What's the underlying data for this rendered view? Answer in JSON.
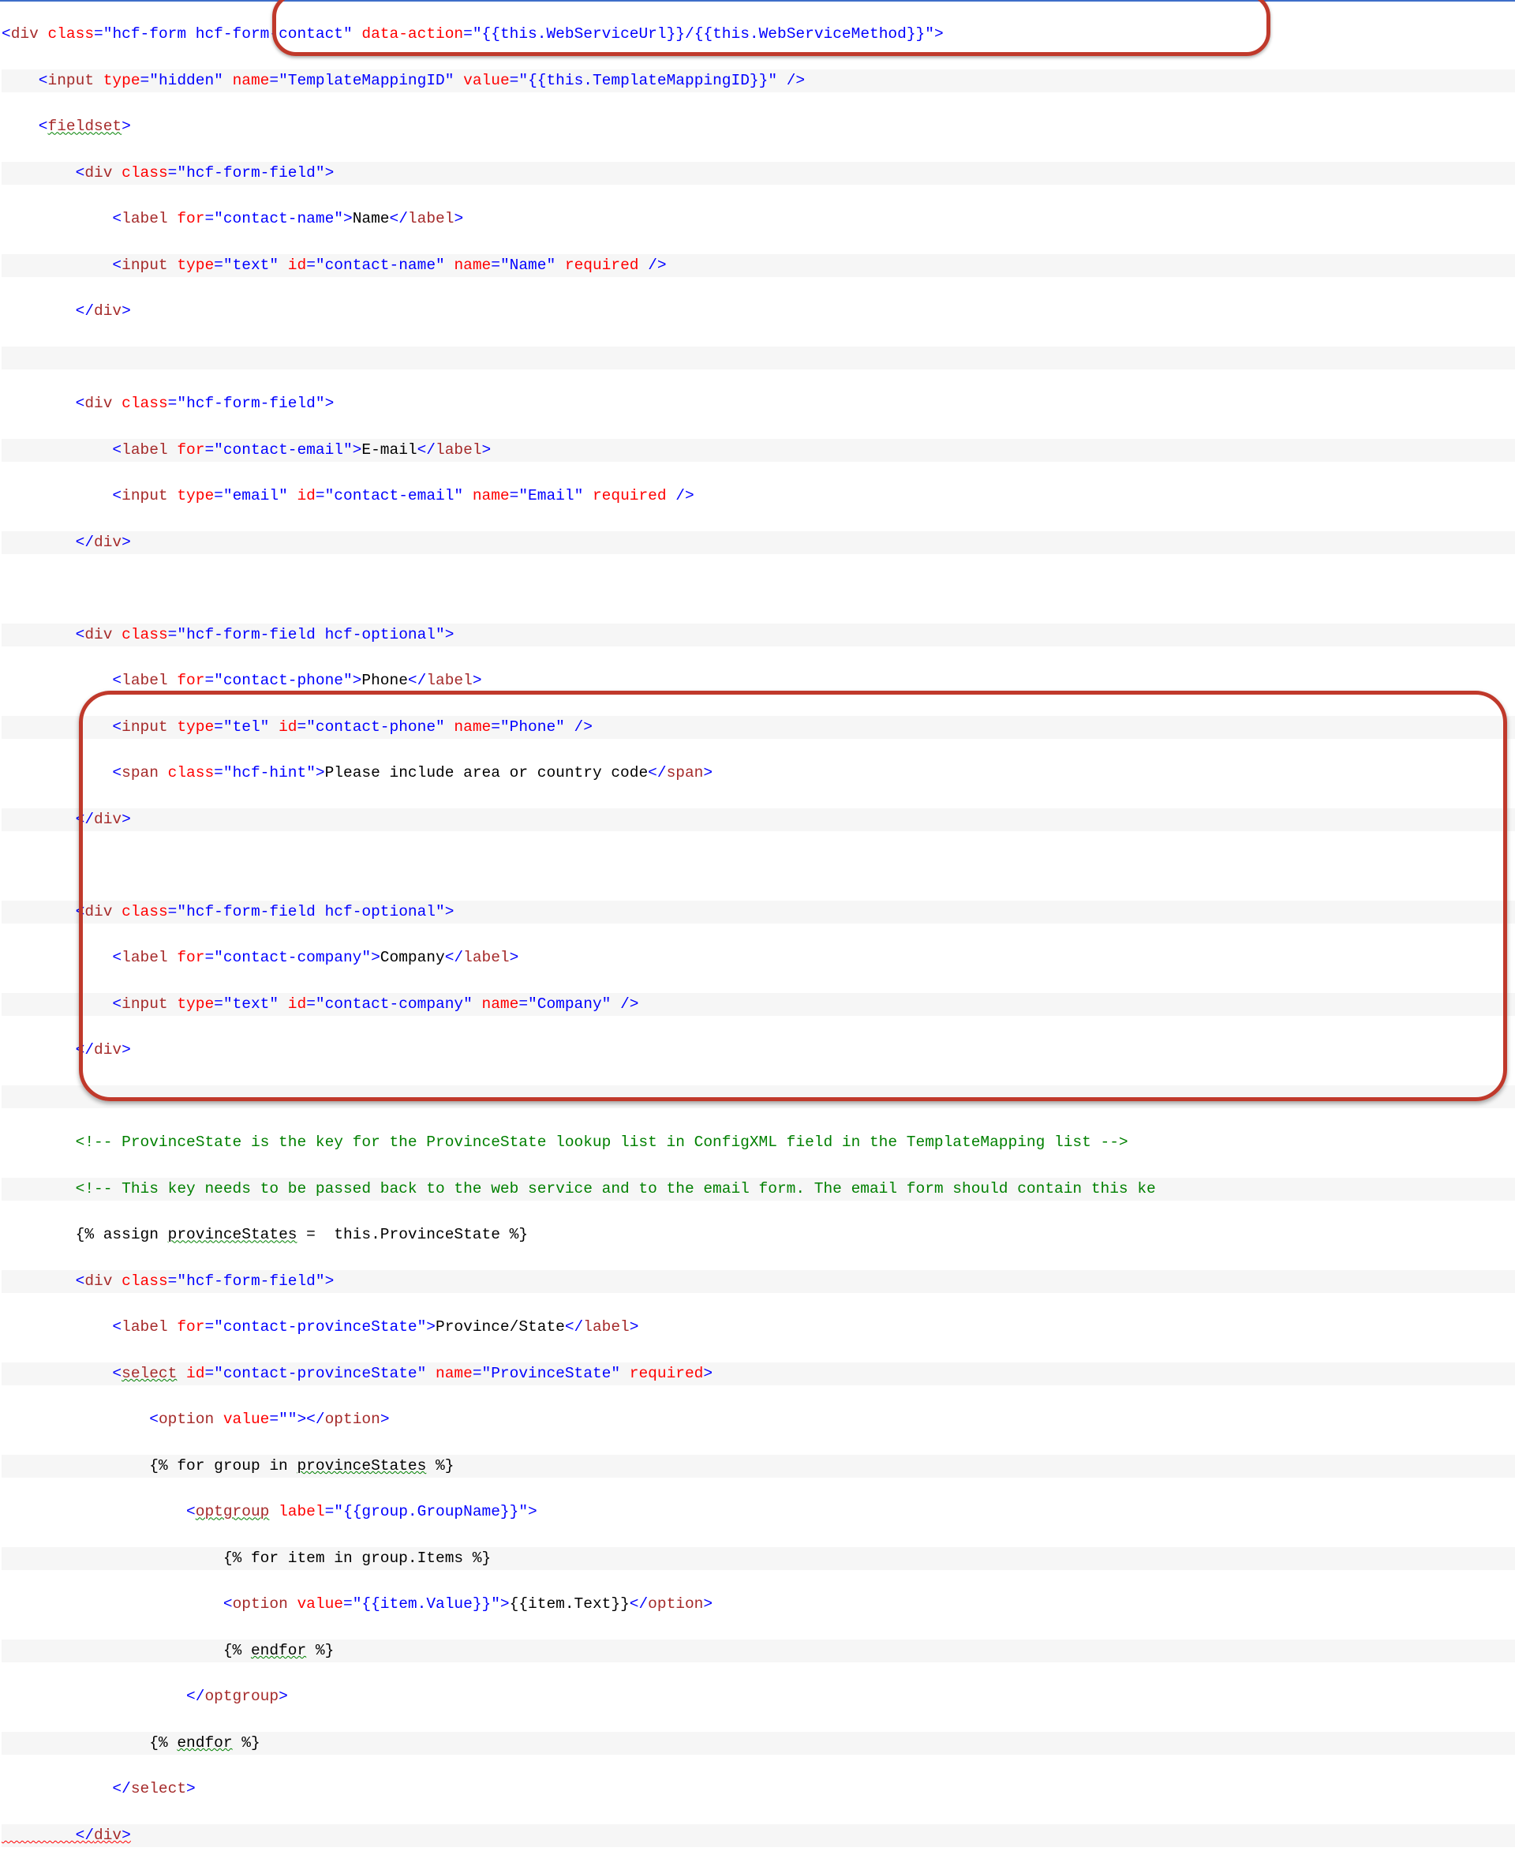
{
  "lines": {
    "l1a": "<",
    "l1_div": "div",
    "l1b": " ",
    "l1_class": "class",
    "l1c": "=\"",
    "l1_classv": "hcf-form hcf-form-contact",
    "l1d": "\" ",
    "l1_action": "data-action",
    "l1e": "=\"",
    "l1_actionv": "{{this.WebServiceUrl}}/{{this.WebServiceMethod}}",
    "l1f": "\">",
    "l2a": "    <",
    "l2_input": "input",
    "l2b": " ",
    "l2_type": "type",
    "l2c": "=\"",
    "l2_typev": "hidden",
    "l2d": "\" ",
    "l2_name": "name",
    "l2e": "=\"",
    "l2_namev": "TemplateMappingID",
    "l2f": "\" ",
    "l2_value": "value",
    "l2g": "=\"",
    "l2_valuev": "{{this.TemplateMappingID}}",
    "l2h": "\" />",
    "l3": "    <",
    "l3_fs": "fieldset",
    "l3b": ">",
    "l4": "        <",
    "l4_div": "div",
    "l4b": " ",
    "l4_class": "class",
    "l4c": "=\"",
    "l4_classv": "hcf-form-field",
    "l4d": "\">",
    "l5": "            <",
    "l5_label": "label",
    "l5b": " ",
    "l5_for": "for",
    "l5c": "=\"",
    "l5_forv": "contact-name",
    "l5d": "\">",
    "l5_txt": "Name",
    "l5e": "</",
    "l5_label2": "label",
    "l5f": ">",
    "l6": "            <",
    "l6_input": "input",
    "l6b": " ",
    "l6_type": "type",
    "l6c": "=\"",
    "l6_typev": "text",
    "l6d": "\" ",
    "l6_id": "id",
    "l6e": "=\"",
    "l6_idv": "contact-name",
    "l6f": "\" ",
    "l6_name": "name",
    "l6g": "=\"",
    "l6_namev": "Name",
    "l6h": "\" ",
    "l6_req": "required",
    "l6i": " />",
    "l7": "        </",
    "l7_div": "div",
    "l7b": ">",
    "l8": " ",
    "l9": "        <",
    "l9_div": "div",
    "l9b": " ",
    "l9_class": "class",
    "l9c": "=\"",
    "l9_classv": "hcf-form-field",
    "l9d": "\">",
    "l10": "            <",
    "l10_label": "label",
    "l10b": " ",
    "l10_for": "for",
    "l10c": "=\"",
    "l10_forv": "contact-email",
    "l10d": "\">",
    "l10_txt": "E-mail",
    "l10e": "</",
    "l10_label2": "label",
    "l10f": ">",
    "l11": "            <",
    "l11_input": "input",
    "l11b": " ",
    "l11_type": "type",
    "l11c": "=\"",
    "l11_typev": "email",
    "l11d": "\" ",
    "l11_id": "id",
    "l11e": "=\"",
    "l11_idv": "contact-email",
    "l11f": "\" ",
    "l11_name": "name",
    "l11g": "=\"",
    "l11_namev": "Email",
    "l11h": "\" ",
    "l11_req": "required",
    "l11i": " />",
    "l12": "        </",
    "l12_div": "div",
    "l12b": ">",
    "l13": " ",
    "l14": "        <",
    "l14_div": "div",
    "l14b": " ",
    "l14_class": "class",
    "l14c": "=\"",
    "l14_classv": "hcf-form-field hcf-optional",
    "l14d": "\">",
    "l15": "            <",
    "l15_label": "label",
    "l15b": " ",
    "l15_for": "for",
    "l15c": "=\"",
    "l15_forv": "contact-phone",
    "l15d": "\">",
    "l15_txt": "Phone",
    "l15e": "</",
    "l15_label2": "label",
    "l15f": ">",
    "l16": "            <",
    "l16_input": "input",
    "l16b": " ",
    "l16_type": "type",
    "l16c": "=\"",
    "l16_typev": "tel",
    "l16d": "\" ",
    "l16_id": "id",
    "l16e": "=\"",
    "l16_idv": "contact-phone",
    "l16f": "\" ",
    "l16_name": "name",
    "l16g": "=\"",
    "l16_namev": "Phone",
    "l16h": "\" />",
    "l17": "            <",
    "l17_span": "span",
    "l17b": " ",
    "l17_class": "class",
    "l17c": "=\"",
    "l17_classv": "hcf-hint",
    "l17d": "\">",
    "l17_txt": "Please include area or country code",
    "l17e": "</",
    "l17_span2": "span",
    "l17f": ">",
    "l18": "        </",
    "l18_div": "div",
    "l18b": ">",
    "l19": " ",
    "l20": "        <",
    "l20_div": "div",
    "l20b": " ",
    "l20_class": "class",
    "l20c": "=\"",
    "l20_classv": "hcf-form-field hcf-optional",
    "l20d": "\">",
    "l21": "            <",
    "l21_label": "label",
    "l21b": " ",
    "l21_for": "for",
    "l21c": "=\"",
    "l21_forv": "contact-company",
    "l21d": "\">",
    "l21_txt": "Company",
    "l21e": "</",
    "l21_label2": "label",
    "l21f": ">",
    "l22": "            <",
    "l22_input": "input",
    "l22b": " ",
    "l22_type": "type",
    "l22c": "=\"",
    "l22_typev": "text",
    "l22d": "\" ",
    "l22_id": "id",
    "l22e": "=\"",
    "l22_idv": "contact-company",
    "l22f": "\" ",
    "l22_name": "name",
    "l22g": "=\"",
    "l22_namev": "Company",
    "l22h": "\" />",
    "l23": "        </",
    "l23_div": "div",
    "l23b": ">",
    "l24": " ",
    "l25": "        <!-- ProvinceState is the key for the ProvinceState lookup list in ConfigXML field in the TemplateMapping list -->",
    "l26": "        <!-- This key needs to be passed back to the web service and to the email form. The email form should contain this ke",
    "l27": "        {% assign ",
    "l27_ps": "provinceStates",
    "l27b": " =  this.ProvinceState %}",
    "l28": "        <",
    "l28_div": "div",
    "l28b": " ",
    "l28_class": "class",
    "l28c": "=\"",
    "l28_classv": "hcf-form-field",
    "l28d": "\">",
    "l29": "            <",
    "l29_label": "label",
    "l29b": " ",
    "l29_for": "for",
    "l29c": "=\"",
    "l29_forv": "contact-provinceState",
    "l29d": "\">",
    "l29_txt": "Province/State",
    "l29e": "</",
    "l29_label2": "label",
    "l29f": ">",
    "l30": "            <",
    "l30_select": "select",
    "l30b": " ",
    "l30_id": "id",
    "l30c": "=\"",
    "l30_idv": "contact-provinceState",
    "l30d": "\" ",
    "l30_name": "name",
    "l30e": "=\"",
    "l30_namev": "ProvinceState",
    "l30f": "\" ",
    "l30_req": "required",
    "l30g": ">",
    "l31": "                <",
    "l31_option": "option",
    "l31b": " ",
    "l31_value": "value",
    "l31c": "=\"\"></",
    "l31_option2": "option",
    "l31d": ">",
    "l32": "                {% for group in ",
    "l32_ps": "provinceStates",
    "l32b": " %}",
    "l33": "                    <",
    "l33_optgroup": "optgroup",
    "l33b": " ",
    "l33_label": "label",
    "l33c": "=\"",
    "l33_labelv": "{{group.GroupName}}",
    "l33d": "\">",
    "l34": "                        {% for item in group.Items %}",
    "l35": "                        <",
    "l35_option": "option",
    "l35b": " ",
    "l35_value": "value",
    "l35c": "=\"",
    "l35_valuev": "{{item.Value}}",
    "l35d": "\">",
    "l35_txt": "{{item.Text}}",
    "l35e": "</",
    "l35_option2": "option",
    "l35f": ">",
    "l36": "                        {% ",
    "l36_endfor": "endfor",
    "l36b": " %}",
    "l37": "                    </",
    "l37_optgroup": "optgroup",
    "l37b": ">",
    "l38": "                {% ",
    "l38_endfor": "endfor",
    "l38b": " %}",
    "l39": "            </",
    "l39_select": "select",
    "l39b": ">",
    "l40": "        </",
    "l40_div": "div",
    "l40b": ">"
  }
}
